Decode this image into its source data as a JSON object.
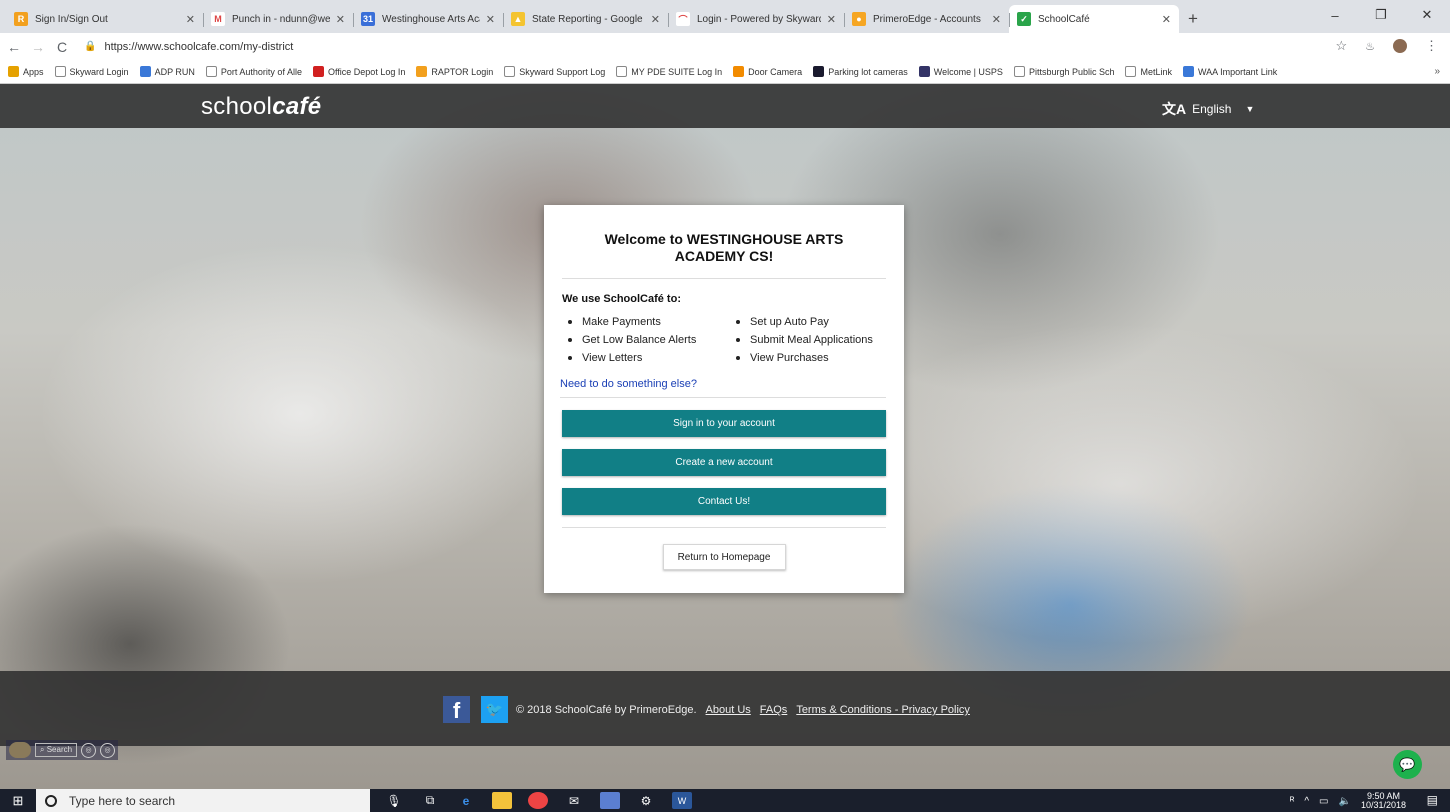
{
  "browser": {
    "tabs": [
      {
        "label": "Sign In/Sign Out",
        "icon": "raptor-icon",
        "color": "#f2a01e",
        "glyph": "R",
        "width": 197
      },
      {
        "label": "Punch in - ndunn@westinghouse",
        "icon": "gmail-icon",
        "color": "#ffffff",
        "glyph": "M",
        "width": 150
      },
      {
        "label": "Westinghouse Arts Academy Cha",
        "icon": "calendar-icon",
        "color": "#3a6fd8",
        "glyph": "31",
        "width": 150
      },
      {
        "label": "State Reporting - Google Drive",
        "icon": "google-drive-icon",
        "color": "#f4c430",
        "glyph": "▲",
        "width": 165
      },
      {
        "label": "Login - Powered by Skyward",
        "icon": "skyward-icon",
        "color": "#ffffff",
        "glyph": "⌒",
        "width": 176
      },
      {
        "label": "PrimeroEdge - Accounts",
        "icon": "primeroedge-icon",
        "color": "#f6a623",
        "glyph": "●",
        "width": 165
      },
      {
        "label": "SchoolCafé",
        "icon": "schoolcafe-icon",
        "color": "#2aa44a",
        "glyph": "✓",
        "width": 170
      }
    ],
    "url": "https://www.schoolcafe.com/my-district",
    "bookmarks": [
      {
        "label": "Apps",
        "color": "#e5a100"
      },
      {
        "label": "Skyward Login",
        "color": "#ffffff"
      },
      {
        "label": "ADP RUN",
        "color": "#3a78d8"
      },
      {
        "label": "Port Authority of Alle",
        "color": "#ffffff"
      },
      {
        "label": "Office Depot Log In",
        "color": "#d12020"
      },
      {
        "label": "RAPTOR Login",
        "color": "#f2a01e"
      },
      {
        "label": "Skyward Support Log",
        "color": "#ffffff"
      },
      {
        "label": "MY PDE SUITE Log In",
        "color": "#ffffff"
      },
      {
        "label": "Door Camera",
        "color": "#f28b00"
      },
      {
        "label": "Parking lot cameras",
        "color": "#1a1a2e"
      },
      {
        "label": "Welcome | USPS",
        "color": "#333366"
      },
      {
        "label": "Pittsburgh Public Sch",
        "color": "#ffffff"
      },
      {
        "label": "MetLink",
        "color": "#ffffff"
      },
      {
        "label": "WAA Important Link",
        "color": "#3a78d8"
      }
    ],
    "bookmarks_more": "»"
  },
  "site": {
    "logo_plain": "school",
    "logo_bold": "café",
    "language": "English"
  },
  "card": {
    "title_line1": "Welcome to WESTINGHOUSE ARTS",
    "title_line2": "ACADEMY CS!",
    "intro": "We use SchoolCafé to:",
    "features": [
      "Make Payments",
      "Set up Auto Pay",
      "Get Low Balance Alerts",
      "Submit Meal Applications",
      "View Letters",
      "View Purchases"
    ],
    "link": "Need to do something else?",
    "sign_in": "Sign in to your account",
    "create": "Create a new account",
    "contact": "Contact Us!",
    "return": "Return to Homepage"
  },
  "footer": {
    "copyright": "© 2018 SchoolCafé by PrimeroEdge.",
    "about": "About Us",
    "faqs": "FAQs",
    "terms": "Terms & Conditions - Privacy Policy"
  },
  "access": {
    "search": "Search"
  },
  "taskbar": {
    "search_placeholder": "Type here to search",
    "time": "9:50 AM",
    "date": "10/31/2018"
  },
  "colors": {
    "button_teal": "#117f86",
    "header_bar": "#323232",
    "link_blue": "#1a3fb5"
  }
}
